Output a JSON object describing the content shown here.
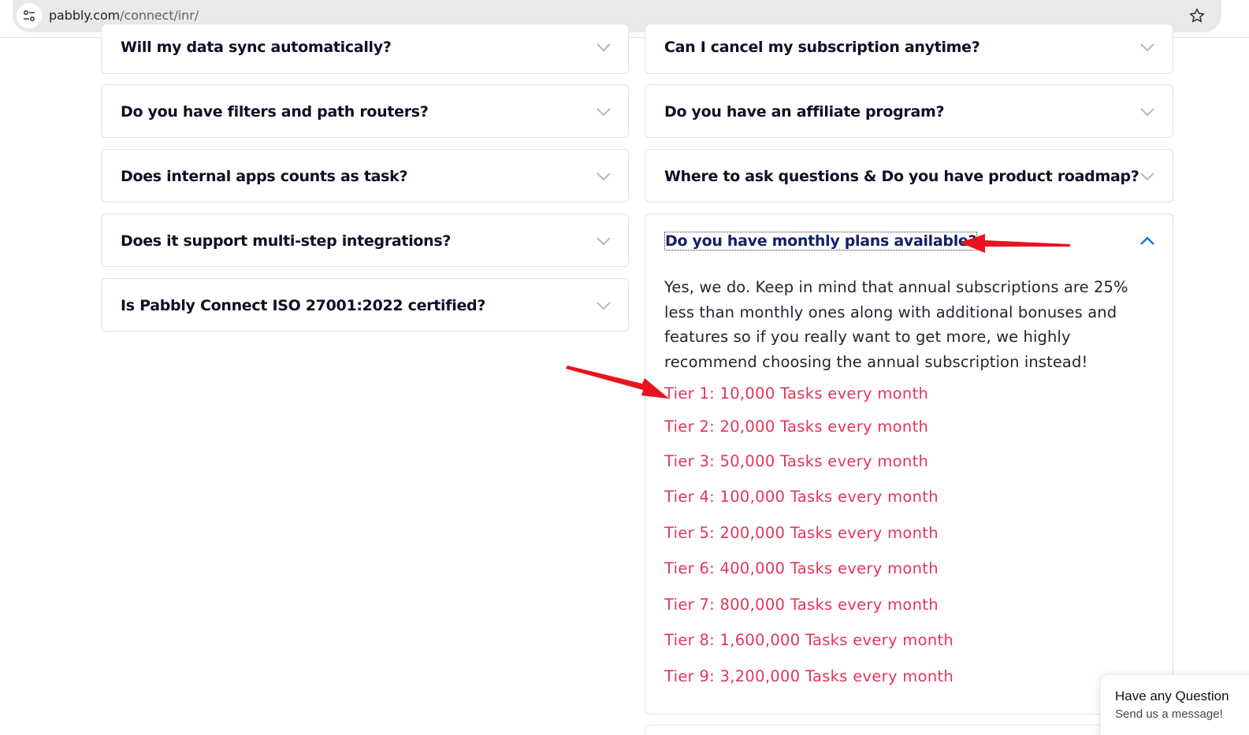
{
  "browser": {
    "url_domain": "pabbly.com",
    "url_path": "/connect/inr/"
  },
  "faq": {
    "left": [
      {
        "question": "Will my data sync automatically?"
      },
      {
        "question": "Do you have filters and path routers?"
      },
      {
        "question": "Does internal apps counts as task?"
      },
      {
        "question": "Does it support multi-step integrations?"
      },
      {
        "question": "Is Pabbly Connect ISO 27001:2022 certified?"
      }
    ],
    "right": [
      {
        "question": "Can I cancel my subscription anytime?"
      },
      {
        "question": "Do you have an affiliate program?"
      },
      {
        "question": "Where to ask questions & Do you have product roadmap?"
      }
    ],
    "expanded": {
      "question": "Do you have monthly plans available?",
      "answer": "Yes, we do. Keep in mind that annual subscriptions are 25% less than monthly ones along with additional bonuses and features so if you really want to get more, we highly recommend choosing the annual subscription instead!",
      "tiers": [
        "Tier 1: 10,000 Tasks every month",
        "Tier 2: 20,000 Tasks every month",
        "Tier 3: 50,000 Tasks every month",
        "Tier 4: 100,000 Tasks every month",
        "Tier 5: 200,000 Tasks every month",
        "Tier 6: 400,000 Tasks every month",
        "Tier 7: 800,000 Tasks every month",
        "Tier 8: 1,600,000 Tasks every month",
        "Tier 9: 3,200,000 Tasks every month"
      ]
    }
  },
  "chat_widget": {
    "title": "Have any Question",
    "subtitle": "Send us a message!"
  },
  "colors": {
    "tier_text": "#e3355a",
    "expanded_chevron": "#1a73e8",
    "annotation_arrow": "#e8141e"
  }
}
